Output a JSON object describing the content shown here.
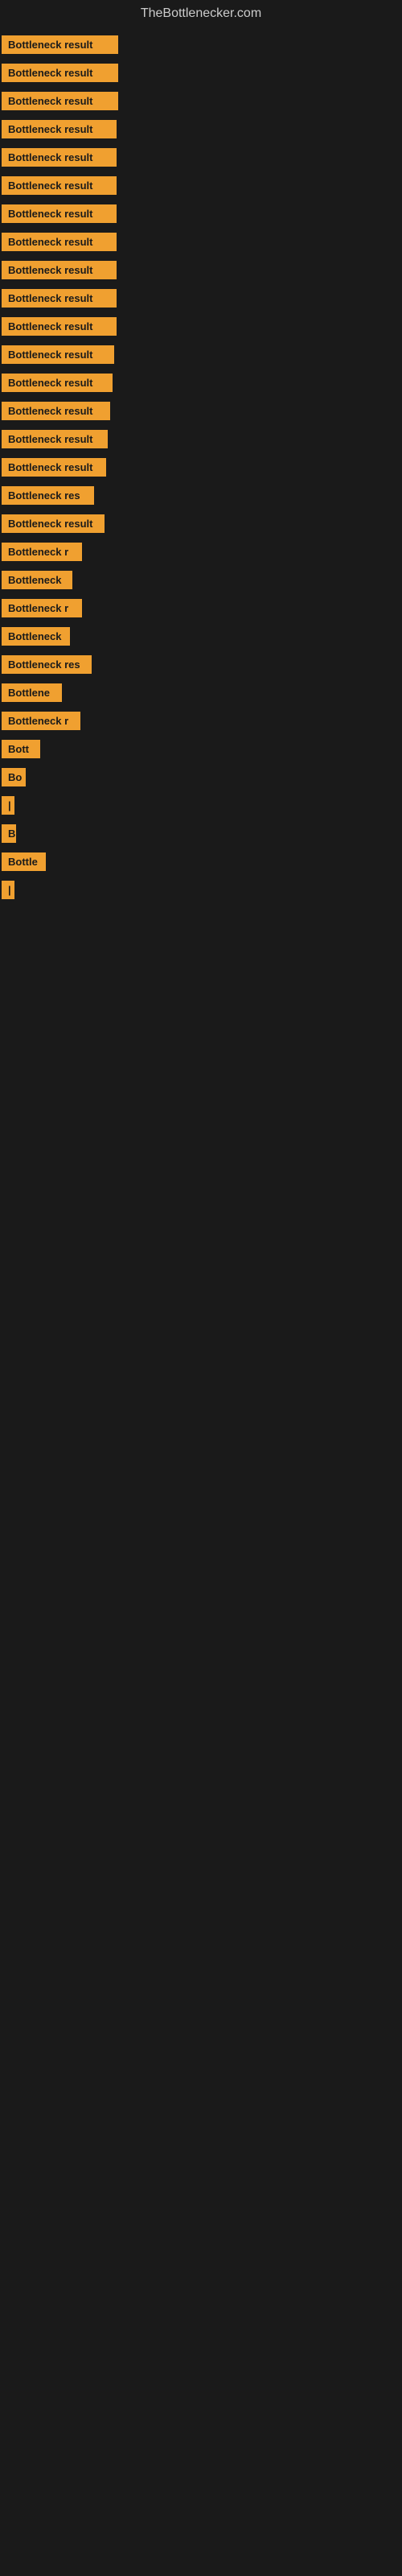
{
  "header": {
    "title": "TheBottlenecker.com"
  },
  "items": [
    {
      "label": "Bottleneck result",
      "width": 145
    },
    {
      "label": "Bottleneck result",
      "width": 145
    },
    {
      "label": "Bottleneck result",
      "width": 145
    },
    {
      "label": "Bottleneck result",
      "width": 143
    },
    {
      "label": "Bottleneck result",
      "width": 143
    },
    {
      "label": "Bottleneck result",
      "width": 143
    },
    {
      "label": "Bottleneck result",
      "width": 143
    },
    {
      "label": "Bottleneck result",
      "width": 143
    },
    {
      "label": "Bottleneck result",
      "width": 143
    },
    {
      "label": "Bottleneck result",
      "width": 143
    },
    {
      "label": "Bottleneck result",
      "width": 143
    },
    {
      "label": "Bottleneck result",
      "width": 140
    },
    {
      "label": "Bottleneck result",
      "width": 138
    },
    {
      "label": "Bottleneck result",
      "width": 135
    },
    {
      "label": "Bottleneck result",
      "width": 132
    },
    {
      "label": "Bottleneck result",
      "width": 130
    },
    {
      "label": "Bottleneck res",
      "width": 115
    },
    {
      "label": "Bottleneck result",
      "width": 128
    },
    {
      "label": "Bottleneck r",
      "width": 100
    },
    {
      "label": "Bottleneck",
      "width": 88
    },
    {
      "label": "Bottleneck r",
      "width": 100
    },
    {
      "label": "Bottleneck",
      "width": 85
    },
    {
      "label": "Bottleneck res",
      "width": 112
    },
    {
      "label": "Bottlene",
      "width": 75
    },
    {
      "label": "Bottleneck r",
      "width": 98
    },
    {
      "label": "Bott",
      "width": 48
    },
    {
      "label": "Bo",
      "width": 30
    },
    {
      "label": "|",
      "width": 10
    },
    {
      "label": "B",
      "width": 18
    },
    {
      "label": "Bottle",
      "width": 55
    },
    {
      "label": "|",
      "width": 8
    }
  ]
}
